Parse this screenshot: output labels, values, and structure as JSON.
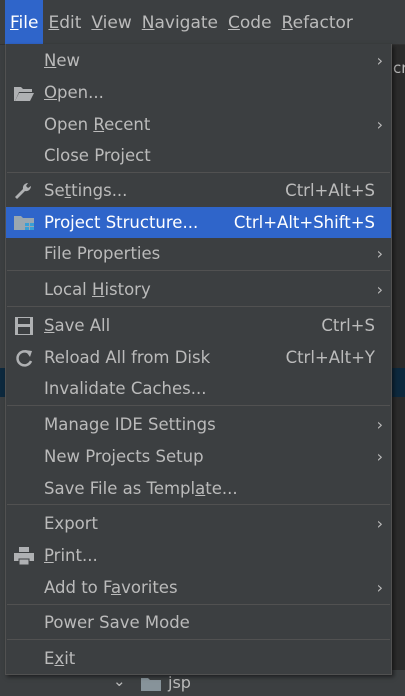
{
  "menubar": {
    "items": [
      {
        "pre": "",
        "mn": "F",
        "post": "ile"
      },
      {
        "pre": "",
        "mn": "E",
        "post": "dit"
      },
      {
        "pre": "",
        "mn": "V",
        "post": "iew"
      },
      {
        "pre": "",
        "mn": "N",
        "post": "avigate"
      },
      {
        "pre": "",
        "mn": "C",
        "post": "ode"
      },
      {
        "pre": "",
        "mn": "R",
        "post": "efactor"
      }
    ]
  },
  "background": {
    "right_tab_text": "cr",
    "tree_folder_label": "jsp"
  },
  "menu": {
    "items": [
      {
        "pre": "",
        "mn": "N",
        "post": "ew",
        "shortcut": "",
        "submenu": true,
        "icon": ""
      },
      {
        "pre": "",
        "mn": "O",
        "post": "pen...",
        "shortcut": "",
        "submenu": false,
        "icon": "folder-open-icon"
      },
      {
        "pre": "Open ",
        "mn": "R",
        "post": "ecent",
        "shortcut": "",
        "submenu": true,
        "icon": ""
      },
      {
        "pre": "Close Pro",
        "mn": "j",
        "post": "ect",
        "shortcut": "",
        "submenu": false,
        "icon": ""
      },
      {
        "pre": "Se",
        "mn": "t",
        "post": "tings...",
        "shortcut": "Ctrl+Alt+S",
        "submenu": false,
        "icon": "wrench-icon"
      },
      {
        "pre": "Project Structure...",
        "mn": "",
        "post": "",
        "shortcut": "Ctrl+Alt+Shift+S",
        "submenu": false,
        "icon": "project-structure-icon"
      },
      {
        "pre": "File Properties",
        "mn": "",
        "post": "",
        "shortcut": "",
        "submenu": true,
        "icon": ""
      },
      {
        "pre": "Local ",
        "mn": "H",
        "post": "istory",
        "shortcut": "",
        "submenu": true,
        "icon": ""
      },
      {
        "pre": "",
        "mn": "S",
        "post": "ave All",
        "shortcut": "Ctrl+S",
        "submenu": false,
        "icon": "save-icon"
      },
      {
        "pre": "Reload All from Disk",
        "mn": "",
        "post": "",
        "shortcut": "Ctrl+Alt+Y",
        "submenu": false,
        "icon": "reload-icon"
      },
      {
        "pre": "Invalidate Caches...",
        "mn": "",
        "post": "",
        "shortcut": "",
        "submenu": false,
        "icon": ""
      },
      {
        "pre": "Manage IDE Settings",
        "mn": "",
        "post": "",
        "shortcut": "",
        "submenu": true,
        "icon": ""
      },
      {
        "pre": "New Projects Setup",
        "mn": "",
        "post": "",
        "shortcut": "",
        "submenu": true,
        "icon": ""
      },
      {
        "pre": "Save File as Templ",
        "mn": "a",
        "post": "te...",
        "shortcut": "",
        "submenu": false,
        "icon": ""
      },
      {
        "pre": "Export",
        "mn": "",
        "post": "",
        "shortcut": "",
        "submenu": true,
        "icon": ""
      },
      {
        "pre": "",
        "mn": "P",
        "post": "rint...",
        "shortcut": "",
        "submenu": false,
        "icon": "print-icon"
      },
      {
        "pre": "Add to F",
        "mn": "a",
        "post": "vorites",
        "shortcut": "",
        "submenu": true,
        "icon": ""
      },
      {
        "pre": "Power Save Mode",
        "mn": "",
        "post": "",
        "shortcut": "",
        "submenu": false,
        "icon": ""
      },
      {
        "pre": "E",
        "mn": "x",
        "post": "it",
        "shortcut": "",
        "submenu": false,
        "icon": ""
      }
    ],
    "selected_label": "Project Structure...",
    "accent_color": "#2f65ca"
  }
}
